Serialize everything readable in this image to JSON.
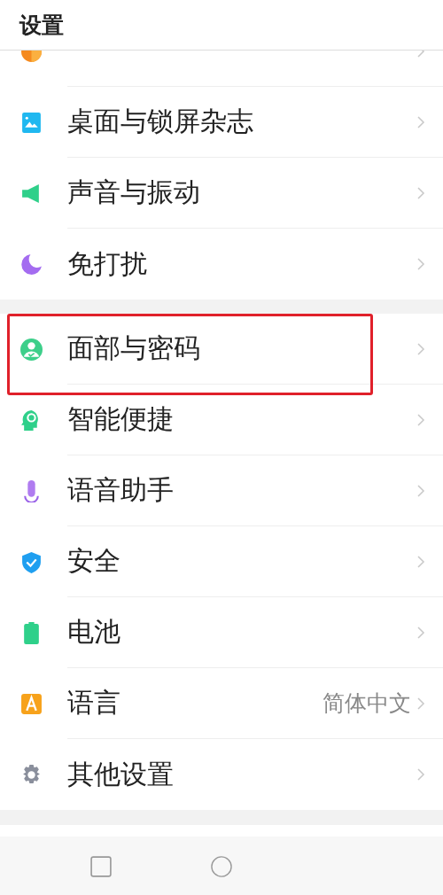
{
  "header": {
    "title": "设置"
  },
  "groups": [
    {
      "items": [
        {
          "kind": "display",
          "partial": true,
          "highlighted": false
        },
        {
          "kind": "wallpaper",
          "label": "桌面与锁屏杂志",
          "highlighted": false
        },
        {
          "kind": "sound",
          "label": "声音与振动",
          "highlighted": false
        },
        {
          "kind": "moon",
          "label": "免打扰",
          "highlighted": false
        }
      ]
    },
    {
      "items": [
        {
          "kind": "face",
          "label": "面部与密码",
          "highlighted": true
        },
        {
          "kind": "smart",
          "label": "智能便捷",
          "highlighted": false
        },
        {
          "kind": "mic",
          "label": "语音助手",
          "highlighted": false
        },
        {
          "kind": "shield",
          "label": "安全",
          "highlighted": false
        },
        {
          "kind": "battery",
          "label": "电池",
          "highlighted": false
        },
        {
          "kind": "language",
          "label": "语言",
          "value": "简体中文",
          "highlighted": false
        },
        {
          "kind": "gear",
          "label": "其他设置",
          "highlighted": false
        }
      ]
    }
  ],
  "nav_bar": {
    "buttons": [
      {
        "kind": "recents"
      },
      {
        "kind": "home"
      }
    ]
  }
}
